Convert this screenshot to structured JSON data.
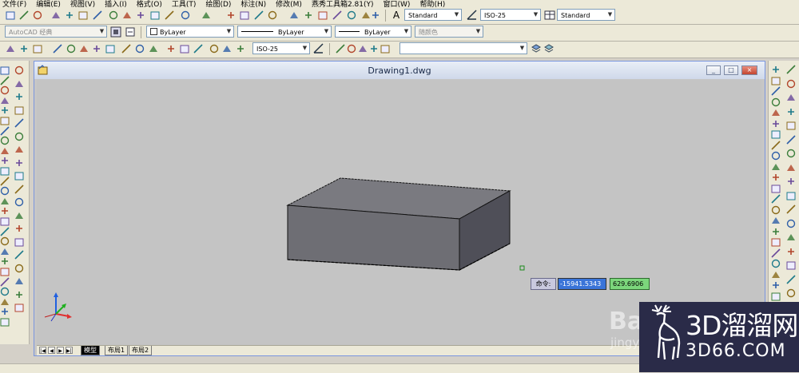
{
  "menu": [
    "文件(F)",
    "编辑(E)",
    "视图(V)",
    "插入(I)",
    "格式(O)",
    "工具(T)",
    "绘图(D)",
    "标注(N)",
    "修改(M)",
    "燕秀工具箱2.81(Y)",
    "窗口(W)",
    "帮助(H)"
  ],
  "toolbar_styles": {
    "text_style": "Standard",
    "dim_style": "ISO-25",
    "table_style": "Standard"
  },
  "toolbar_props": {
    "workspace": "AutoCAD 经典",
    "layer": "ByLayer",
    "linetype": "ByLayer",
    "lineweight": "ByLayer",
    "color": "随颜色"
  },
  "toolbar_dim": {
    "dim_style": "ISO-25"
  },
  "window": {
    "title": "Drawing1.dwg",
    "minimize": "_",
    "restore": "□",
    "close": "×"
  },
  "tabs": [
    "模型",
    "布局1",
    "布局2"
  ],
  "tab_nav": [
    "|◀",
    "◀",
    "▶",
    "▶|"
  ],
  "command": {
    "label": "命令:",
    "x_value": "-15941.5343",
    "y_value": "629.6906"
  },
  "watermark": {
    "logo_main": "3D溜溜网",
    "logo_sub": "3D66.COM",
    "baidu": "Bai",
    "jingyan": "jingyan"
  },
  "colors": {
    "viewport": "#c4c4c4",
    "box_front": "#6e6e74",
    "box_top": "#7a7a80",
    "box_right": "#4f4f58",
    "x_axis": "#e03030",
    "y_axis": "#20b020",
    "z_axis": "#2060e0",
    "logo_bg": "#2a2b48"
  }
}
